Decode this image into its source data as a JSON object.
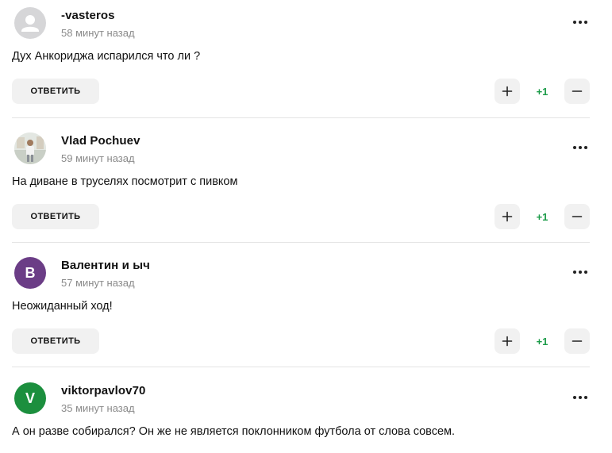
{
  "comments": [
    {
      "author": "-vasteros",
      "time": "58 минут назад",
      "avatar": "default-user-icon",
      "text": "Дух Анкориджа испарился что ли ?",
      "reply_label": "ОТВЕТИТЬ",
      "score": "+1"
    },
    {
      "author": "Vlad Pochuev",
      "time": "59 минут назад",
      "avatar": "photo",
      "text": "На диване в труселях посмотрит с пивком",
      "reply_label": "ОТВЕТИТЬ",
      "score": "+1"
    },
    {
      "author": "Валентин и ыч",
      "time": "57 минут назад",
      "avatar_letter": "В",
      "text": "Неожиданный ход!",
      "reply_label": "ОТВЕТИТЬ",
      "score": "+1"
    },
    {
      "author": "viktorpavlov70",
      "time": "35 минут назад",
      "avatar_letter": "V",
      "text": "А он разве собирался? Он же не является поклонником футбола от слова совсем."
    }
  ],
  "colors": {
    "score_positive": "#1d9c4a",
    "avatar_purple": "#6b3d86",
    "avatar_green": "#1c8f3e",
    "button_bg": "#f1f1f1",
    "meta_gray": "#8a8a8a"
  }
}
